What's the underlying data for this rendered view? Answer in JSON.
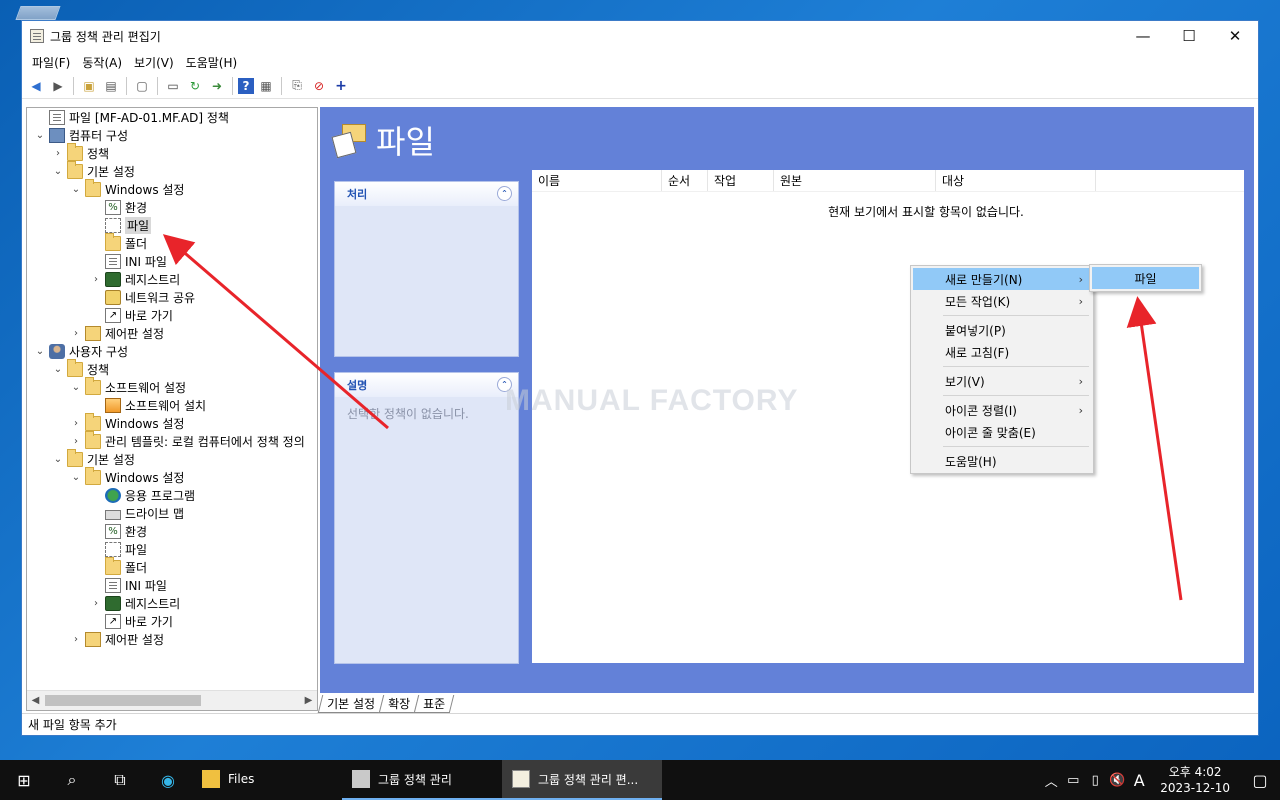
{
  "window": {
    "title": "그룹 정책 관리 편집기",
    "controls": [
      "—",
      "☐",
      "✕"
    ]
  },
  "menu": [
    "파일(F)",
    "동작(A)",
    "보기(V)",
    "도움말(H)"
  ],
  "tree": [
    {
      "level": 0,
      "toggle": "",
      "icon": "doc",
      "label": "파일 [MF-AD-01.MF.AD] 정책"
    },
    {
      "level": 0,
      "toggle": "v",
      "icon": "comp",
      "label": "컴퓨터 구성"
    },
    {
      "level": 1,
      "toggle": ">",
      "icon": "folder",
      "label": "정책"
    },
    {
      "level": 1,
      "toggle": "v",
      "icon": "folder",
      "label": "기본 설정"
    },
    {
      "level": 2,
      "toggle": "v",
      "icon": "folder",
      "label": "Windows 설정"
    },
    {
      "level": 3,
      "toggle": "",
      "icon": "gear",
      "label": "환경"
    },
    {
      "level": 3,
      "toggle": "",
      "icon": "file",
      "label": "파일",
      "selected": true
    },
    {
      "level": 3,
      "toggle": "",
      "icon": "folder",
      "label": "폴더"
    },
    {
      "level": 3,
      "toggle": "",
      "icon": "doc",
      "label": "INI 파일"
    },
    {
      "level": 3,
      "toggle": ">",
      "icon": "reg",
      "label": "레지스트리"
    },
    {
      "level": 3,
      "toggle": "",
      "icon": "net",
      "label": "네트워크 공유"
    },
    {
      "level": 3,
      "toggle": "",
      "icon": "short",
      "label": "바로 가기"
    },
    {
      "level": 2,
      "toggle": ">",
      "icon": "ctrl",
      "label": "제어판 설정"
    },
    {
      "level": 0,
      "toggle": "v",
      "icon": "user",
      "label": "사용자 구성"
    },
    {
      "level": 1,
      "toggle": "v",
      "icon": "folder",
      "label": "정책"
    },
    {
      "level": 2,
      "toggle": "v",
      "icon": "folder",
      "label": "소프트웨어 설정"
    },
    {
      "level": 3,
      "toggle": "",
      "icon": "pkg",
      "label": "소프트웨어 설치"
    },
    {
      "level": 2,
      "toggle": ">",
      "icon": "folder",
      "label": "Windows 설정"
    },
    {
      "level": 2,
      "toggle": ">",
      "icon": "folder",
      "label": "관리 템플릿: 로컬 컴퓨터에서 정책 정의"
    },
    {
      "level": 1,
      "toggle": "v",
      "icon": "folder",
      "label": "기본 설정"
    },
    {
      "level": 2,
      "toggle": "v",
      "icon": "folder",
      "label": "Windows 설정"
    },
    {
      "level": 3,
      "toggle": "",
      "icon": "app",
      "label": "응용 프로그램"
    },
    {
      "level": 3,
      "toggle": "",
      "icon": "drive",
      "label": "드라이브 맵"
    },
    {
      "level": 3,
      "toggle": "",
      "icon": "gear",
      "label": "환경"
    },
    {
      "level": 3,
      "toggle": "",
      "icon": "file",
      "label": "파일"
    },
    {
      "level": 3,
      "toggle": "",
      "icon": "folder",
      "label": "폴더"
    },
    {
      "level": 3,
      "toggle": "",
      "icon": "doc",
      "label": "INI 파일"
    },
    {
      "level": 3,
      "toggle": ">",
      "icon": "reg",
      "label": "레지스트리"
    },
    {
      "level": 3,
      "toggle": "",
      "icon": "short",
      "label": "바로 가기"
    },
    {
      "level": 2,
      "toggle": ">",
      "icon": "ctrl",
      "label": "제어판 설정"
    }
  ],
  "content": {
    "title": "파일",
    "tasks_label": "처리",
    "desc_label": "설명",
    "desc_text": "선택한 정책이 없습니다.",
    "columns": [
      "이름",
      "순서",
      "작업",
      "원본",
      "대상"
    ],
    "empty_message": "현재 보기에서 표시할 항목이 없습니다."
  },
  "tabs": [
    "기본 설정",
    "확장",
    "표준"
  ],
  "status": "새 파일 항목 추가",
  "context_menu": [
    {
      "label": "새로 만들기(N)",
      "submenu": true,
      "highlight": true
    },
    {
      "label": "모든 작업(K)",
      "submenu": true
    },
    {
      "sep": true
    },
    {
      "label": "붙여넣기(P)"
    },
    {
      "label": "새로 고침(F)"
    },
    {
      "sep": true
    },
    {
      "label": "보기(V)",
      "submenu": true
    },
    {
      "sep": true
    },
    {
      "label": "아이콘 정렬(I)",
      "submenu": true
    },
    {
      "label": "아이콘 줄 맞춤(E)"
    },
    {
      "sep": true
    },
    {
      "label": "도움말(H)"
    }
  ],
  "submenu_item": "파일",
  "watermark": "MANUAL FACTORY",
  "taskbar": {
    "apps": [
      {
        "label": "Files",
        "state": ""
      },
      {
        "label": "그룹 정책 관리",
        "state": "run"
      },
      {
        "label": "그룹 정책 관리 편...",
        "state": "active"
      }
    ],
    "tray_lang": "A",
    "time": "오후 4:02",
    "date": "2023-12-10"
  },
  "colors": {
    "content_bg": "#6381d8",
    "highlight": "#91c9f7",
    "annotation_arrow": "#e8242a",
    "taskbar": "#101010"
  }
}
